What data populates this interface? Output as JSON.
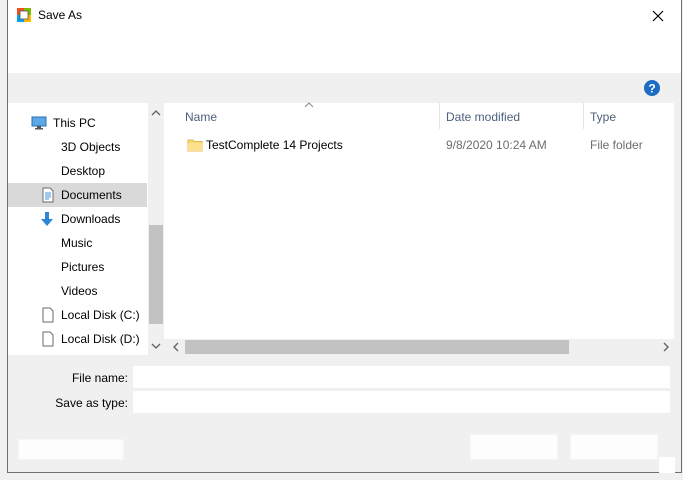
{
  "window": {
    "title": "Save As"
  },
  "nav": {
    "items": [
      {
        "label": "This PC",
        "icon": "monitor-icon",
        "level": 0,
        "selected": false
      },
      {
        "label": "3D Objects",
        "icon": "",
        "level": 1,
        "selected": false
      },
      {
        "label": "Desktop",
        "icon": "",
        "level": 1,
        "selected": false
      },
      {
        "label": "Documents",
        "icon": "document-icon",
        "level": 1,
        "selected": true
      },
      {
        "label": "Downloads",
        "icon": "download-arrow-icon",
        "level": 1,
        "selected": false
      },
      {
        "label": "Music",
        "icon": "",
        "level": 1,
        "selected": false
      },
      {
        "label": "Pictures",
        "icon": "",
        "level": 1,
        "selected": false
      },
      {
        "label": "Videos",
        "icon": "",
        "level": 1,
        "selected": false
      },
      {
        "label": "Local Disk (C:)",
        "icon": "drive-icon",
        "level": 1,
        "selected": false
      },
      {
        "label": "Local Disk (D:)",
        "icon": "drive-icon",
        "level": 1,
        "selected": false
      }
    ]
  },
  "filelist": {
    "columns": {
      "name": "Name",
      "date": "Date modified",
      "type": "Type"
    },
    "rows": [
      {
        "name": "TestComplete 14 Projects",
        "date": "9/8/2020 10:24 AM",
        "type": "File folder",
        "icon": "folder-icon"
      }
    ]
  },
  "form": {
    "filename_label": "File name:",
    "filename_value": "",
    "savetype_label": "Save as type:",
    "savetype_value": ""
  },
  "colors": {
    "header_text": "#4c607a",
    "selected_bg": "#d9d9d9",
    "help_blue": "#1c6bc5"
  }
}
